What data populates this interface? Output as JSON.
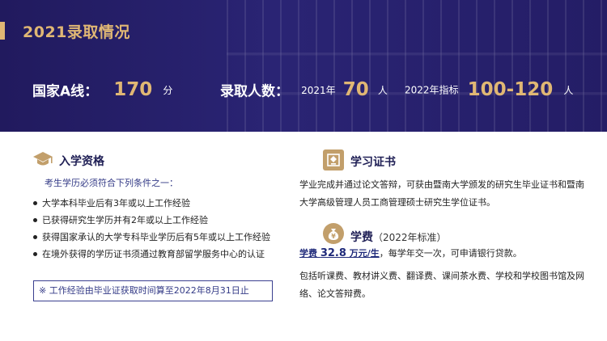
{
  "banner": {
    "title": "2021录取情况",
    "line_label": "国家A线：",
    "line_value": "170",
    "line_unit": "分",
    "admit_label": "录取人数：",
    "year2021_label": "2021年",
    "year2021_value": "70",
    "year2021_unit": "人",
    "year2022_label": "2022年指标",
    "year2022_value": "100-120",
    "year2022_unit": "人"
  },
  "requirements": {
    "icon": "graduation-cap-icon",
    "title": "入学资格",
    "note": "考生学历必须符合下列条件之一：",
    "items": [
      "大学本科毕业后有3年或以上工作经验",
      "已获得研究生学历并有2年或以上工作经验",
      "获得国家承认的大学专科毕业学历后有5年或以上工作经验",
      "在境外获得的学历证书须通过教育部留学服务中心的认证"
    ],
    "notice": "※ 工作经验由毕业证获取时间算至2022年8月31日止"
  },
  "certificate": {
    "icon": "certificate-icon",
    "title": "学习证书",
    "text": "学业完成并通过论文答辩，可获由暨南大学颁发的研究生毕业证书和暨南大学高级管理人员工商管理硕士研究生学位证书。"
  },
  "tuition": {
    "icon": "money-bag-icon",
    "title": "学费",
    "subtitle": "（2022年标准）",
    "fee_prefix": "学费 ",
    "fee_amount": "32.8",
    "fee_unit": " 万元/生",
    "fee_rest": "，每学年交一次，可申请银行贷款。",
    "includes": "包括听课费、教材讲义费、翻译费、课间茶水费、学校和学校图书馆及网络、论文答辩费。"
  },
  "colors": {
    "banner_bg": "#2a2474",
    "gold": "#e0b774",
    "icon_bg": "#c29f6b",
    "navy_text": "#1f1f55"
  }
}
